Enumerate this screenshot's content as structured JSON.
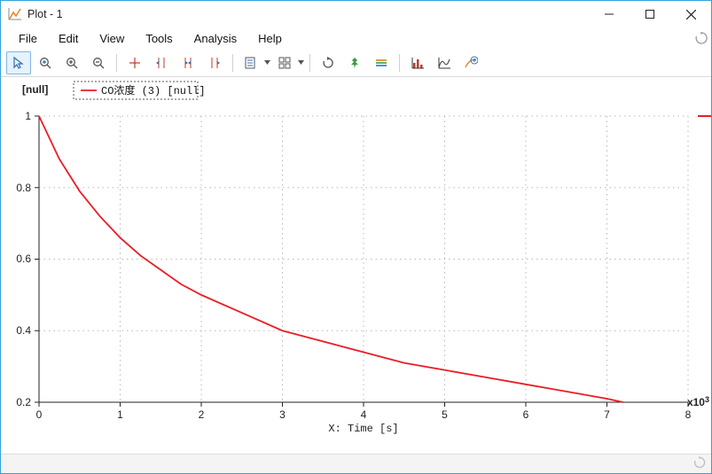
{
  "window": {
    "title": "Plot - 1"
  },
  "menu": {
    "file": "File",
    "edit": "Edit",
    "view": "View",
    "tools": "Tools",
    "analysis": "Analysis",
    "help": "Help"
  },
  "chart_data": {
    "type": "line",
    "title": "",
    "xlabel": "X: Time [s]",
    "ylabel": "[null]",
    "x_exponent_label": "x10^3",
    "xlim": [
      0,
      8000
    ],
    "ylim": [
      0.2,
      1.0
    ],
    "x_ticks": [
      0,
      1,
      2,
      3,
      4,
      5,
      6,
      7,
      8
    ],
    "y_ticks": [
      0.2,
      0.4,
      0.6,
      0.8,
      1.0
    ],
    "legend": "CO浓度 (3) [null]",
    "series": [
      {
        "name": "CO浓度 (3) [null]",
        "color": "#ec1c24",
        "x": [
          0,
          250,
          500,
          750,
          1000,
          1250,
          1500,
          1750,
          2000,
          2500,
          3000,
          3500,
          4000,
          4500,
          5000,
          5500,
          6000,
          6500,
          7000,
          7200
        ],
        "y": [
          1.0,
          0.88,
          0.79,
          0.72,
          0.66,
          0.61,
          0.57,
          0.53,
          0.5,
          0.45,
          0.4,
          0.37,
          0.34,
          0.31,
          0.29,
          0.27,
          0.25,
          0.23,
          0.21,
          0.2
        ]
      }
    ]
  }
}
